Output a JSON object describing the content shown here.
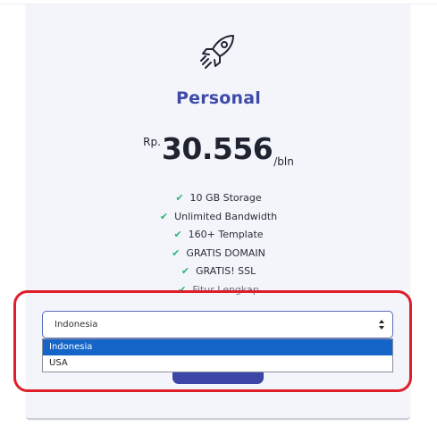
{
  "plan": {
    "name": "Personal",
    "icon": "rocket-icon",
    "currency": "Rp.",
    "amount": "30.556",
    "period": "/bln",
    "features": [
      "10 GB Storage",
      "Unlimited Bandwidth",
      "160+ Template",
      "GRATIS DOMAIN",
      "GRATIS! SSL",
      "Fitur Lengkap"
    ]
  },
  "country_select": {
    "value": "Indonesia",
    "options": [
      "Indonesia",
      "USA"
    ],
    "selected_index": 0
  },
  "colors": {
    "accent": "#3f4aa8",
    "check": "#2bb673",
    "highlight": "#e01e2a",
    "option_selected": "#1565c8"
  }
}
